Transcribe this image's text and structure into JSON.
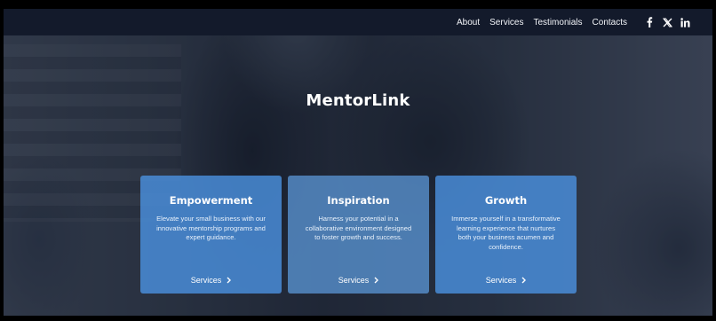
{
  "nav": {
    "links": [
      "About",
      "Services",
      "Testimonials",
      "Contacts"
    ],
    "social": [
      "facebook-icon",
      "x-icon",
      "linkedin-icon"
    ]
  },
  "hero": {
    "title": "MentorLink"
  },
  "cards": [
    {
      "title": "Empowerment",
      "description": "Elevate your small business with our innovative mentorship programs and expert guidance.",
      "link": "Services"
    },
    {
      "title": "Inspiration",
      "description": "Harness your potential in a collaborative environment designed to foster growth and success.",
      "link": "Services"
    },
    {
      "title": "Growth",
      "description": "Immerse yourself in a transformative learning experience that nurtures both your business acumen and confidence.",
      "link": "Services"
    }
  ],
  "colors": {
    "nav_bg": "#131a2b",
    "card_bg": "#4a90de",
    "text": "#ffffff"
  }
}
